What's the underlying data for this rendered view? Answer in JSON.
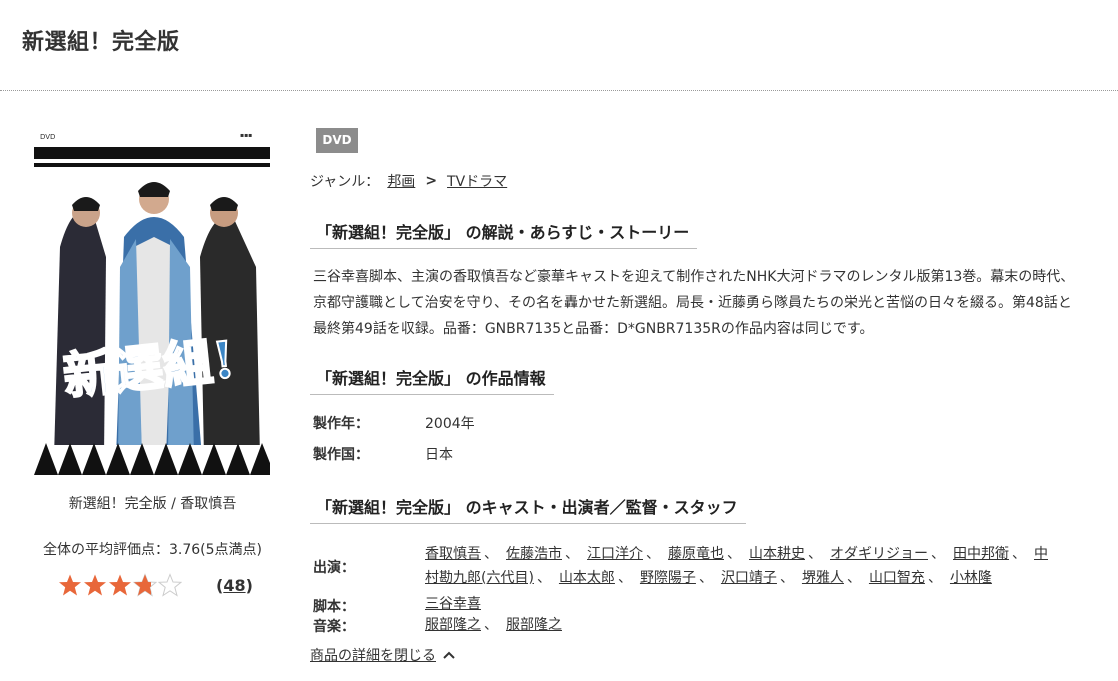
{
  "page": {
    "title": "新選組！完全版"
  },
  "product": {
    "cover_caption": "新選組！完全版 / 香取慎吾",
    "rating_label": "全体の平均評価点：3.76(5点満点)",
    "rating_value": 3.76,
    "rating_max": 5,
    "review_count": "48",
    "review_paren_open": "(",
    "review_paren_close": ")"
  },
  "cover_art": {
    "corner_left": "DVD",
    "title_art": "新選組!"
  },
  "badge": "DVD",
  "genre": {
    "label": "ジャンル：",
    "items": [
      "邦画",
      "TVドラマ"
    ],
    "separator": ">"
  },
  "sections": {
    "synopsis": {
      "quote_title": "「新選組！完全版」",
      "suffix": "の解説・あらすじ・ストーリー",
      "text": "三谷幸喜脚本、主演の香取慎吾など豪華キャストを迎えて制作されたNHK大河ドラマのレンタル版第13巻。幕末の時代、京都守護職として治安を守り、その名を轟かせた新選組。局長・近藤勇ら隊員たちの栄光と苦悩の日々を綴る。第48話と最終第49話を収録。品番：GNBR7135と品番：D*GNBR7135Rの作品内容は同じです。"
    },
    "info": {
      "quote_title": "「新選組！完全版」",
      "suffix": "の作品情報",
      "rows": [
        {
          "key": "製作年：",
          "value": "2004年"
        },
        {
          "key": "製作国：",
          "value": "日本"
        }
      ]
    },
    "cast": {
      "quote_title": "「新選組！完全版」",
      "suffix": "のキャスト・出演者／監督・スタッフ",
      "performers_label": "出演：",
      "performers_line1": [
        "香取慎吾",
        "佐藤浩市",
        "江口洋介",
        "藤原竜也",
        "山本耕史",
        "オダギリジョー",
        "田中邦衛",
        "中"
      ],
      "performers_line2": [
        "村勘九郎(六代目)",
        "山本太郎",
        "野際陽子",
        "沢口靖子",
        "堺雅人",
        "山口智充",
        "小林隆"
      ],
      "writer_label": "脚本：",
      "writers": [
        "三谷幸喜"
      ],
      "music_label": "音楽：",
      "music": [
        "服部隆之",
        "服部隆之"
      ],
      "comma": "、"
    }
  },
  "close_details": "商品の詳細を閉じる",
  "colors": {
    "star": "#e8673a",
    "star_empty": "#cccccc",
    "badge": "#8c8c8c"
  }
}
